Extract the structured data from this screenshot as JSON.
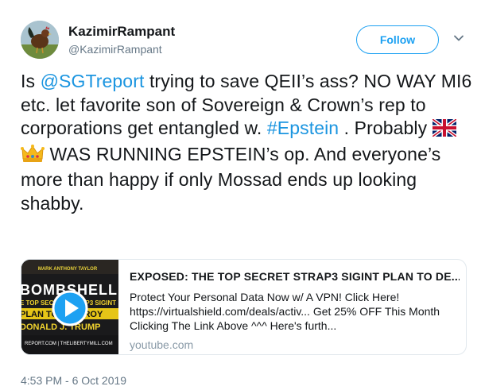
{
  "author": {
    "display_name": "KazimirRampant",
    "handle": "@KazimirRampant"
  },
  "follow_label": "Follow",
  "tweet": {
    "t1": "Is ",
    "mention": "@SGTreport",
    "t2": " trying to save QEII’s ass? NO WAY MI6 etc. let favorite son of Sovereign & Crown’s rep to corporations get entangled w. ",
    "hashtag": "#Epstein",
    "t3": " . Probably ",
    "t4": " WAS RUNNING EPSTEIN’s op. And everyone’s more than happy if only Mossad ends up looking shabby."
  },
  "card": {
    "title": "EXPOSED: THE TOP SECRET STRAP3 SIGINT PLAN TO DE...",
    "description": "Protect Your Personal Data Now w/ A VPN! Click Here! https://virtualshield.com/deals/activ... Get 25% OFF This Month Clicking The Link Above ^^^ Here's furth...",
    "domain": "youtube.com",
    "thumb": {
      "top_text": "MARK ANTHONY TAYLOR",
      "bombshell": "BOMBSHELL",
      "line1": "E TOP SECRET STRAP3 SIGINT",
      "line2": "PLAN TO DESTROY",
      "line3": "DONALD J. TRUMP",
      "footer": "REPORT.COM | THELIBERTYMILL.COM"
    }
  },
  "timestamp": "4:53 PM - 6 Oct 2019",
  "icons": {
    "avatar": "rooster-avatar",
    "caret": "chevron-down-icon",
    "flag": "uk-flag-emoji",
    "crown": "crown-emoji",
    "play": "play-icon"
  },
  "colors": {
    "link": "#1b95e0",
    "follow": "#1da1f2",
    "muted": "#657786"
  }
}
